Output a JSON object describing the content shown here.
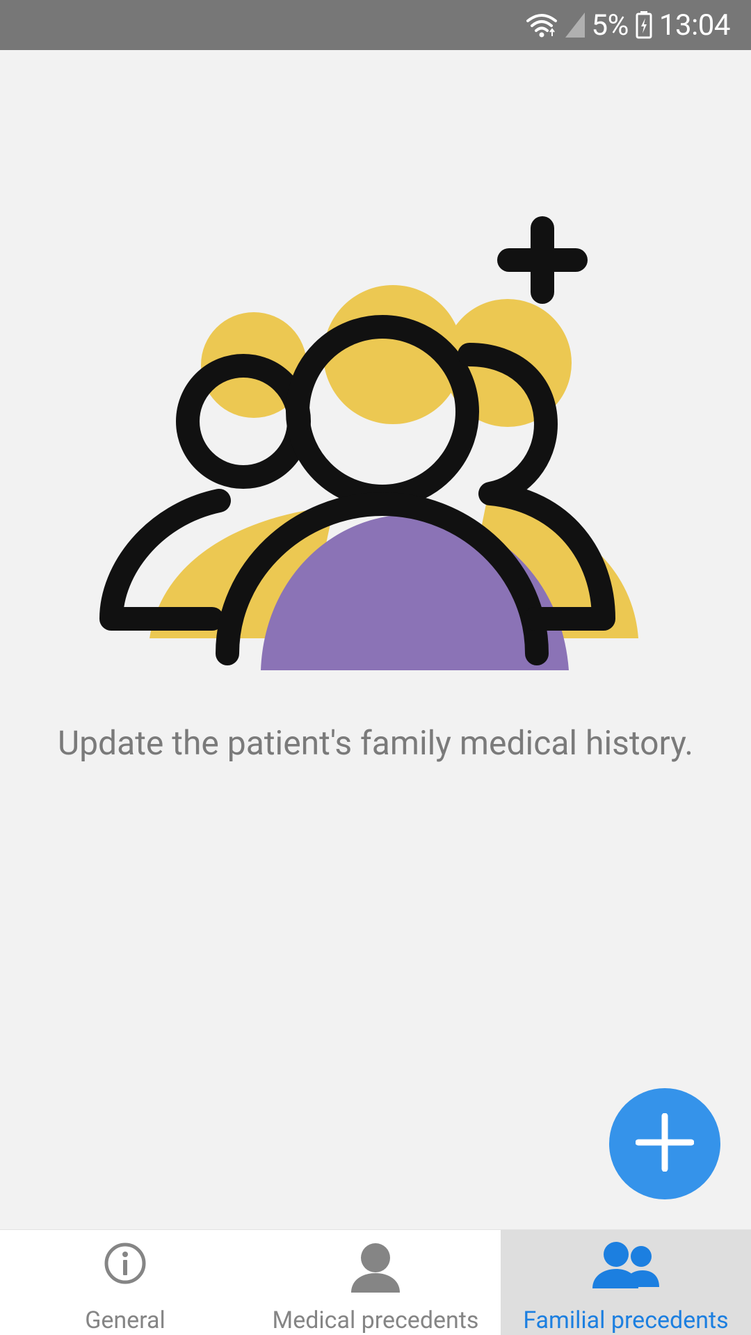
{
  "status_bar": {
    "battery_percent": "5%",
    "time": "13:04",
    "icons": [
      "wifi-icon",
      "signal-icon",
      "battery-icon"
    ]
  },
  "main": {
    "illustration": "family-add-illustration",
    "message": "Update the patient's family medical history."
  },
  "fab": {
    "icon": "plus-icon",
    "color": "#3593ea"
  },
  "bottom_nav": {
    "items": [
      {
        "label": "General",
        "icon": "info-icon",
        "selected": false
      },
      {
        "label": "Medical precedents",
        "icon": "person-icon",
        "selected": false
      },
      {
        "label": "Familial precedents",
        "icon": "people-icon",
        "selected": true
      }
    ],
    "active_color": "#1c7fe0",
    "inactive_color": "#858585"
  },
  "colors": {
    "status_bar": "#777777",
    "background": "#f2f2f2",
    "illustration_yellow": "#ecc852",
    "illustration_purple": "#8b73b6"
  }
}
